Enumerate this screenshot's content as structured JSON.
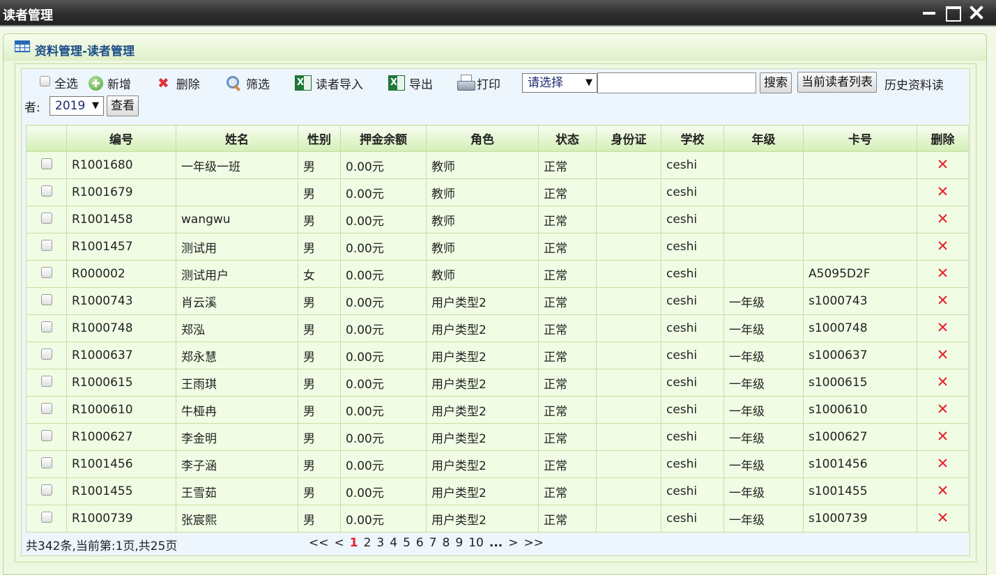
{
  "window": {
    "title": "读者管理"
  },
  "panel": {
    "title": "资料管理-读者管理"
  },
  "toolbar": {
    "select_all": "全选",
    "add": "新增",
    "delete": "删除",
    "filter": "筛选",
    "import": "读者导入",
    "export": "导出",
    "print": "打印",
    "field_select": "请选择",
    "search_value": "",
    "search": "搜索",
    "current_list": "当前读者列表",
    "history_label_1": "历史资料读",
    "history_label_2": "者:",
    "year": "2019",
    "view": "查看"
  },
  "table": {
    "headers": [
      "",
      "编号",
      "姓名",
      "性别",
      "押金余额",
      "角色",
      "状态",
      "身份证",
      "学校",
      "年级",
      "卡号",
      "删除"
    ],
    "rows": [
      {
        "id": "R1001680",
        "name": "一年级一班",
        "gender": "男",
        "deposit": "0.00元",
        "role": "教师",
        "status": "正常",
        "idcard": "",
        "school": "ceshi",
        "grade": "",
        "card": ""
      },
      {
        "id": "R1001679",
        "name": "",
        "gender": "男",
        "deposit": "0.00元",
        "role": "教师",
        "status": "正常",
        "idcard": "",
        "school": "ceshi",
        "grade": "",
        "card": ""
      },
      {
        "id": "R1001458",
        "name": "wangwu",
        "gender": "男",
        "deposit": "0.00元",
        "role": "教师",
        "status": "正常",
        "idcard": "",
        "school": "ceshi",
        "grade": "",
        "card": ""
      },
      {
        "id": "R1001457",
        "name": "测试用",
        "gender": "男",
        "deposit": "0.00元",
        "role": "教师",
        "status": "正常",
        "idcard": "",
        "school": "ceshi",
        "grade": "",
        "card": ""
      },
      {
        "id": "R000002",
        "name": "测试用户",
        "gender": "女",
        "deposit": "0.00元",
        "role": "教师",
        "status": "正常",
        "idcard": "",
        "school": "ceshi",
        "grade": "",
        "card": "A5095D2F"
      },
      {
        "id": "R1000743",
        "name": "肖云溪",
        "gender": "男",
        "deposit": "0.00元",
        "role": "用户类型2",
        "status": "正常",
        "idcard": "",
        "school": "ceshi",
        "grade": "一年级",
        "card": "s1000743"
      },
      {
        "id": "R1000748",
        "name": "郑泓",
        "gender": "男",
        "deposit": "0.00元",
        "role": "用户类型2",
        "status": "正常",
        "idcard": "",
        "school": "ceshi",
        "grade": "一年级",
        "card": "s1000748"
      },
      {
        "id": "R1000637",
        "name": "郑永慧",
        "gender": "男",
        "deposit": "0.00元",
        "role": "用户类型2",
        "status": "正常",
        "idcard": "",
        "school": "ceshi",
        "grade": "一年级",
        "card": "s1000637"
      },
      {
        "id": "R1000615",
        "name": "王雨琪",
        "gender": "男",
        "deposit": "0.00元",
        "role": "用户类型2",
        "status": "正常",
        "idcard": "",
        "school": "ceshi",
        "grade": "一年级",
        "card": "s1000615"
      },
      {
        "id": "R1000610",
        "name": "牛桠冉",
        "gender": "男",
        "deposit": "0.00元",
        "role": "用户类型2",
        "status": "正常",
        "idcard": "",
        "school": "ceshi",
        "grade": "一年级",
        "card": "s1000610"
      },
      {
        "id": "R1000627",
        "name": "李金明",
        "gender": "男",
        "deposit": "0.00元",
        "role": "用户类型2",
        "status": "正常",
        "idcard": "",
        "school": "ceshi",
        "grade": "一年级",
        "card": "s1000627"
      },
      {
        "id": "R1001456",
        "name": "李子涵",
        "gender": "男",
        "deposit": "0.00元",
        "role": "用户类型2",
        "status": "正常",
        "idcard": "",
        "school": "ceshi",
        "grade": "一年级",
        "card": "s1001456"
      },
      {
        "id": "R1001455",
        "name": "王雪茹",
        "gender": "男",
        "deposit": "0.00元",
        "role": "用户类型2",
        "status": "正常",
        "idcard": "",
        "school": "ceshi",
        "grade": "一年级",
        "card": "s1001455"
      },
      {
        "id": "R1000739",
        "name": "张宸熙",
        "gender": "男",
        "deposit": "0.00元",
        "role": "用户类型2",
        "status": "正常",
        "idcard": "",
        "school": "ceshi",
        "grade": "一年级",
        "card": "s1000739"
      }
    ],
    "delete_mark": "✕"
  },
  "pagination": {
    "summary": "共342条,当前第:1页,共25页",
    "first": "<<",
    "prev": "<",
    "pages": [
      "1",
      "2",
      "3",
      "4",
      "5",
      "6",
      "7",
      "8",
      "9",
      "10"
    ],
    "current_page": "1",
    "ellipsis": "...",
    "next": ">",
    "last": ">>"
  },
  "colors": {
    "accent": "#e5202a",
    "title_blue": "#1c4e88",
    "header_green": "#d3eeb5",
    "row_bg": "#f1fce4"
  },
  "icons": [
    "add-icon",
    "delete-icon",
    "filter-icon",
    "excel-icon",
    "printer-icon",
    "table-icon",
    "minimize-icon",
    "maximize-icon",
    "close-icon"
  ]
}
